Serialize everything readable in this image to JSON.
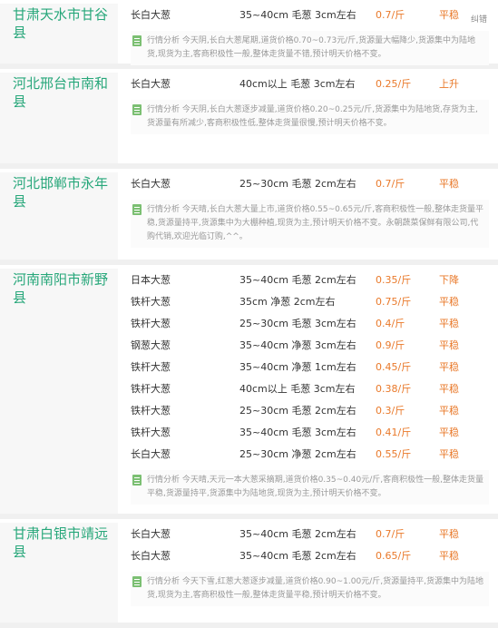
{
  "blocks": [
    {
      "region": "甘肃天水市甘谷县",
      "error_link": "纠错",
      "rows": [
        {
          "name": "长白大葱",
          "spec": "35~40cm 毛葱 3cm左右",
          "price": "0.7/斤",
          "trend": "平稳"
        }
      ],
      "analysis": "行情分析 今天阴,长白大葱尾期,道货价格0.70~0.73元/斤,货源量大幅降少,货源集中为陆地货,现货为主,客商积极性一般,整体走货量不错,预计明天价格不变。"
    },
    {
      "region": "河北邢台市南和县",
      "rows": [
        {
          "name": "长白大葱",
          "spec": "40cm以上 毛葱 3cm左右",
          "price": "0.25/斤",
          "trend": "上升"
        }
      ],
      "analysis": "行情分析 今天阴,长白大葱逐步减量,道货价格0.20~0.25元/斤,货源集中为陆地货,存货为主,货源量有所减少,客商积极性低,整体走货量很慢,预计明天价格不变。"
    },
    {
      "region": "河北邯郸市永年县",
      "rows": [
        {
          "name": "长白大葱",
          "spec": "25~30cm 毛葱 2cm左右",
          "price": "0.7/斤",
          "trend": "平稳"
        }
      ],
      "analysis": "行情分析 今天晴,长白大葱大量上市,道货价格0.55~0.65元/斤,客商积极性一般,整体走货量平稳,货源量持平,货源集中为大棚种植,现货为主,预计明天价格不变。永朝蔬菜保鲜有限公司,代购代销,欢迎光临订购,^^。"
    },
    {
      "region": "河南南阳市新野县",
      "rows": [
        {
          "name": "日本大葱",
          "spec": "35~40cm 毛葱 2cm左右",
          "price": "0.35/斤",
          "trend": "下降"
        },
        {
          "name": "铁杆大葱",
          "spec": "35cm 净葱 2cm左右",
          "price": "0.75/斤",
          "trend": "平稳"
        },
        {
          "name": "铁杆大葱",
          "spec": "25~30cm 毛葱 3cm左右",
          "price": "0.4/斤",
          "trend": "平稳"
        },
        {
          "name": "钢葱大葱",
          "spec": "35~40cm 净葱 3cm左右",
          "price": "0.9/斤",
          "trend": "平稳"
        },
        {
          "name": "铁杆大葱",
          "spec": "35~40cm 净葱 1cm左右",
          "price": "0.45/斤",
          "trend": "平稳"
        },
        {
          "name": "铁杆大葱",
          "spec": "40cm以上 毛葱 3cm左右",
          "price": "0.38/斤",
          "trend": "平稳"
        },
        {
          "name": "铁杆大葱",
          "spec": "25~30cm 毛葱 2cm左右",
          "price": "0.3/斤",
          "trend": "平稳"
        },
        {
          "name": "铁杆大葱",
          "spec": "35~40cm 毛葱 3cm左右",
          "price": "0.41/斤",
          "trend": "平稳"
        },
        {
          "name": "长白大葱",
          "spec": "25~30cm 净葱 2cm左右",
          "price": "0.55/斤",
          "trend": "平稳"
        }
      ],
      "analysis": "行情分析 今天晴,天元一本大葱采摘期,道货价格0.35~0.40元/斤,客商积极性一般,整体走货量平稳,货源量持平,货源集中为陆地货,现货为主,预计明天价格不变。"
    },
    {
      "region": "甘肃白银市靖远县",
      "rows": [
        {
          "name": "长白大葱",
          "spec": "35~40cm 毛葱 2cm左右",
          "price": "0.7/斤",
          "trend": "平稳"
        },
        {
          "name": "长白大葱",
          "spec": "35~40cm 毛葱 2cm左右",
          "price": "0.65/斤",
          "trend": "平稳"
        }
      ],
      "analysis": "行情分析 今天下雪,红葱大葱逐步减量,道货价格0.90~1.00元/斤,货源量持平,货源集中为陆地货,现货为主,客商积极性一般,整体走货量平稳,预计明天价格不变。"
    }
  ]
}
